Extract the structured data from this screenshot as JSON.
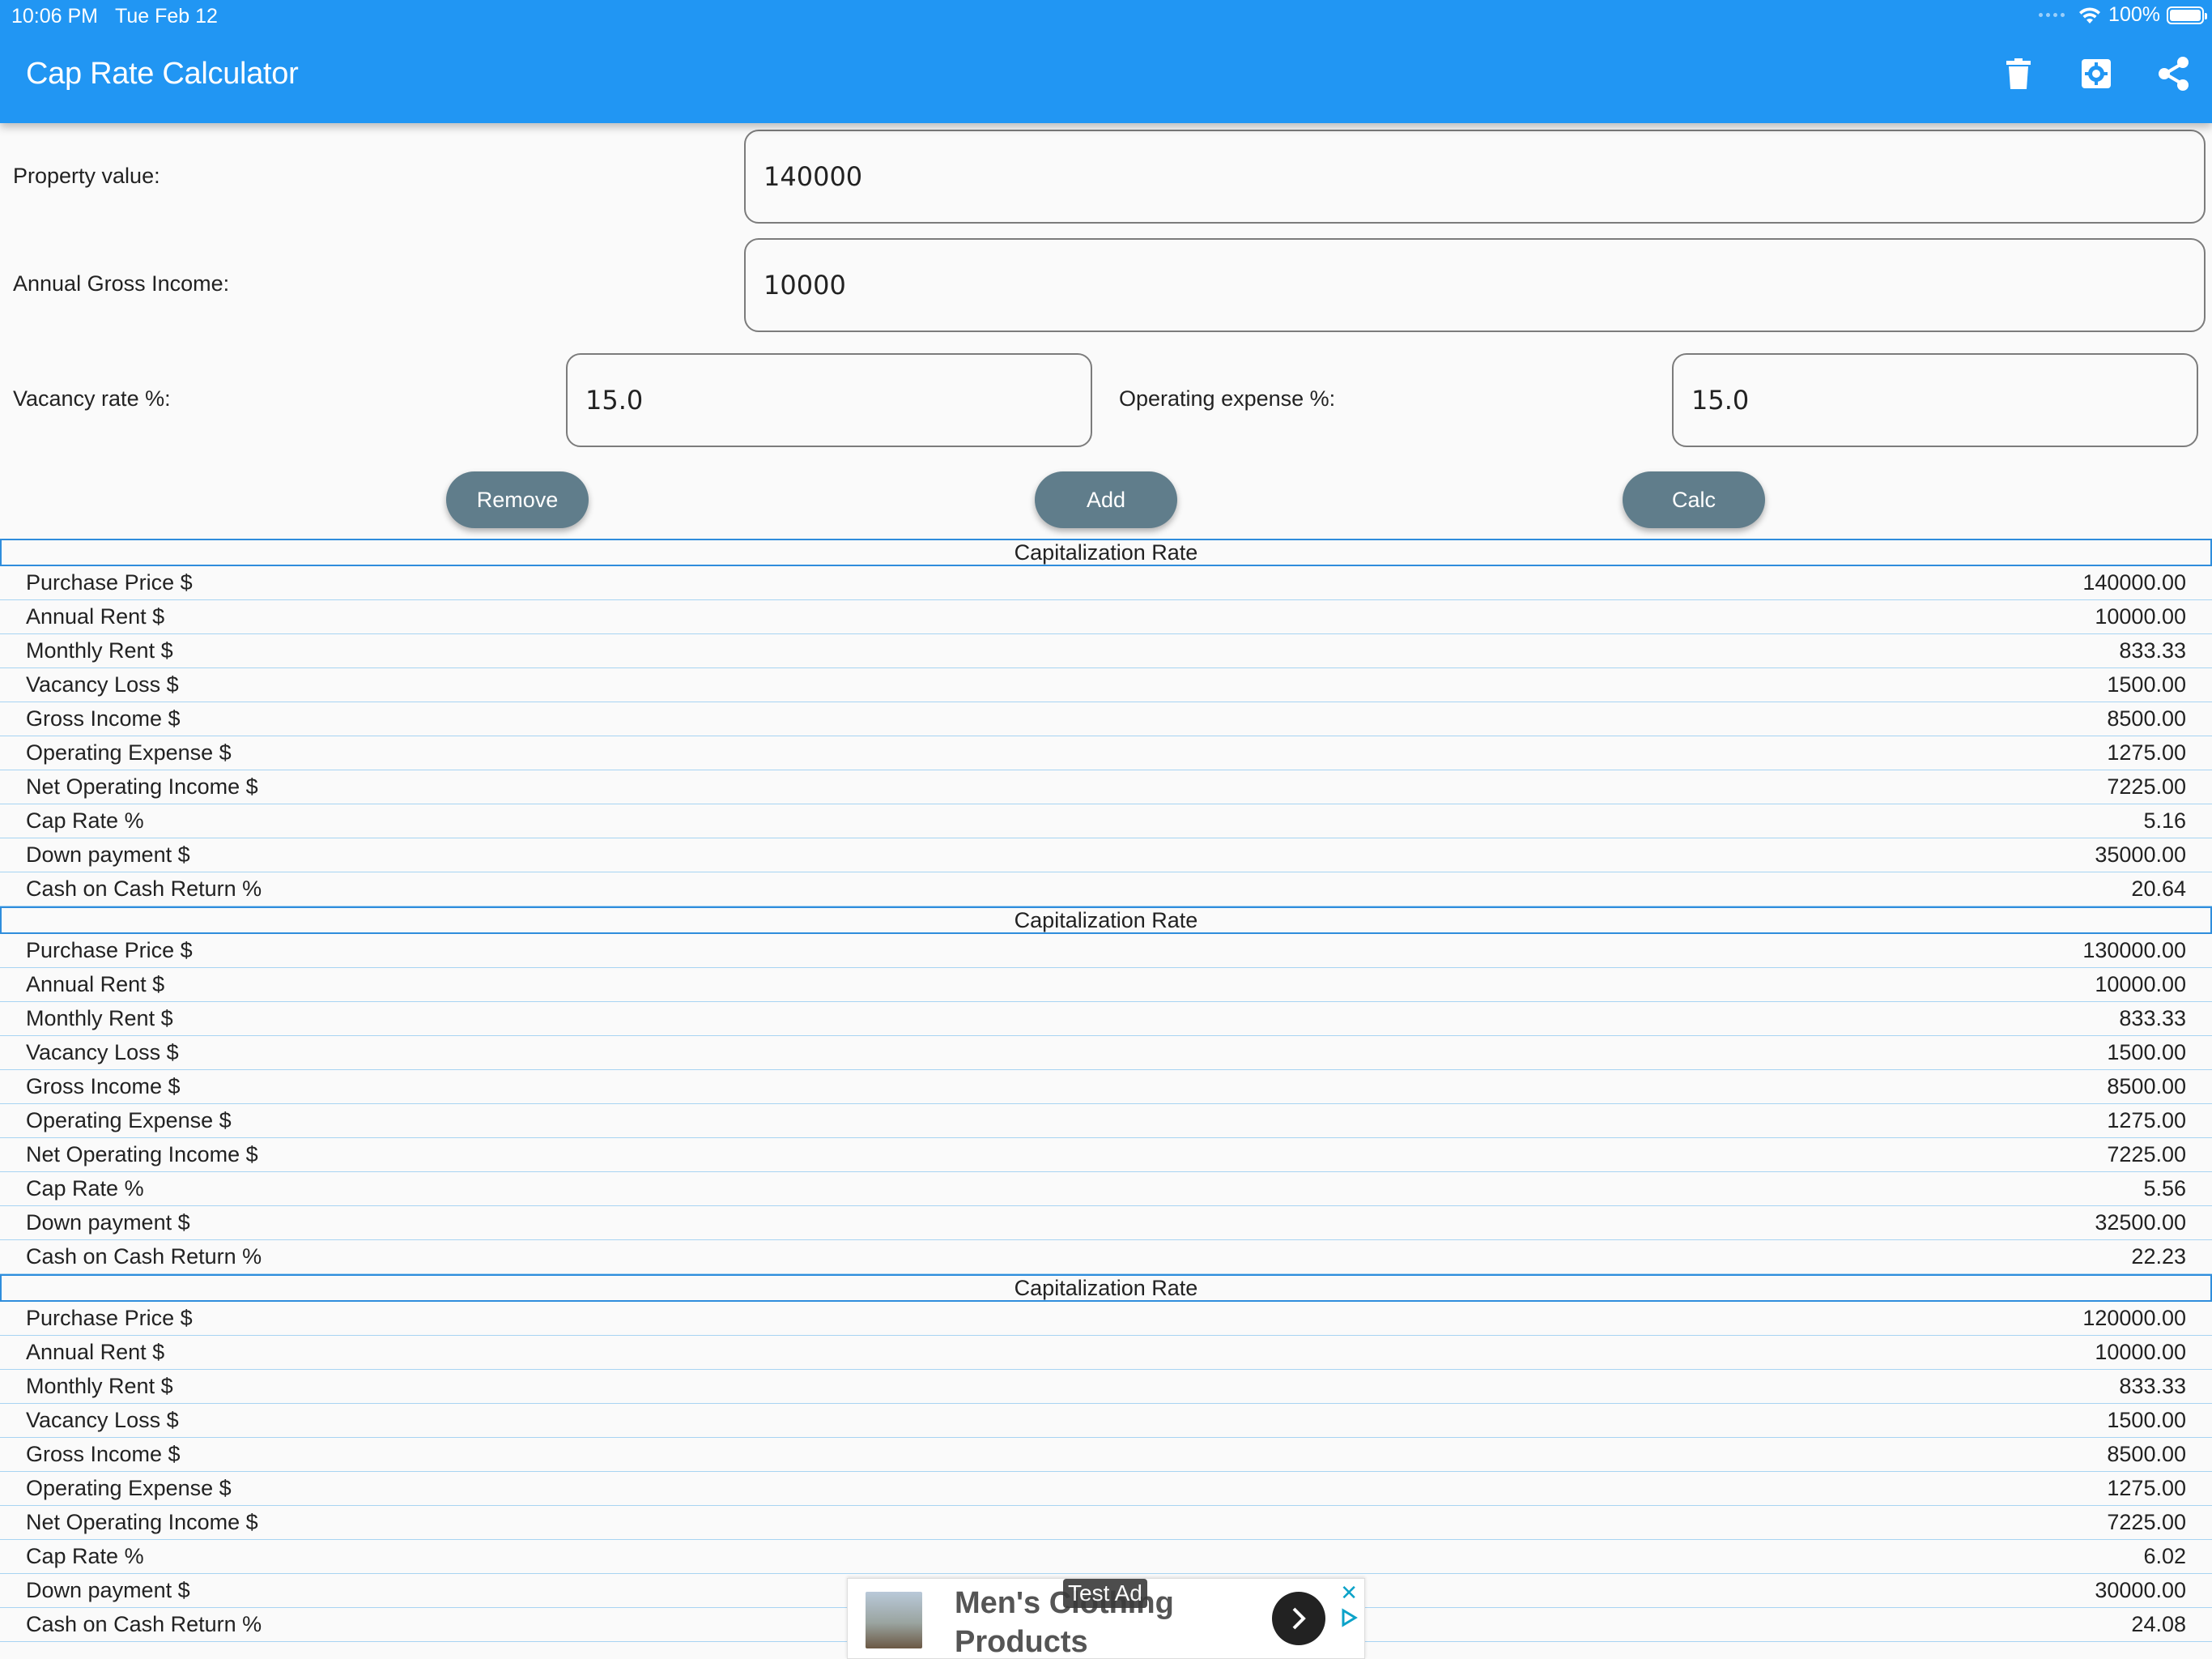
{
  "status_bar": {
    "time": "10:06 PM",
    "date": "Tue Feb 12",
    "battery": "100%"
  },
  "app_bar": {
    "title": "Cap Rate Calculator"
  },
  "form": {
    "property_value_label": "Property value:",
    "property_value": "140000",
    "annual_gross_income_label": "Annual Gross Income:",
    "annual_gross_income": "10000",
    "vacancy_rate_label": "Vacancy rate %:",
    "vacancy_rate": "15.0",
    "operating_expense_label": "Operating expense %:",
    "operating_expense": "15.0"
  },
  "buttons": {
    "remove": "Remove",
    "add": "Add",
    "calc": "Calc"
  },
  "results": [
    {
      "header": "Capitalization Rate",
      "rows": [
        {
          "k": "Purchase Price $",
          "v": "140000.00"
        },
        {
          "k": "Annual Rent $",
          "v": "10000.00"
        },
        {
          "k": "Monthly Rent $",
          "v": "833.33"
        },
        {
          "k": "Vacancy Loss $",
          "v": "1500.00"
        },
        {
          "k": "Gross Income $",
          "v": "8500.00"
        },
        {
          "k": "Operating Expense $",
          "v": "1275.00"
        },
        {
          "k": "Net Operating Income $",
          "v": "7225.00"
        },
        {
          "k": "Cap Rate %",
          "v": "5.16"
        },
        {
          "k": "Down payment $",
          "v": "35000.00"
        },
        {
          "k": "Cash on Cash Return %",
          "v": "20.64"
        }
      ]
    },
    {
      "header": "Capitalization Rate",
      "rows": [
        {
          "k": "Purchase Price $",
          "v": "130000.00"
        },
        {
          "k": "Annual Rent $",
          "v": "10000.00"
        },
        {
          "k": "Monthly Rent $",
          "v": "833.33"
        },
        {
          "k": "Vacancy Loss $",
          "v": "1500.00"
        },
        {
          "k": "Gross Income $",
          "v": "8500.00"
        },
        {
          "k": "Operating Expense $",
          "v": "1275.00"
        },
        {
          "k": "Net Operating Income $",
          "v": "7225.00"
        },
        {
          "k": "Cap Rate %",
          "v": "5.56"
        },
        {
          "k": "Down payment $",
          "v": "32500.00"
        },
        {
          "k": "Cash on Cash Return %",
          "v": "22.23"
        }
      ]
    },
    {
      "header": "Capitalization Rate",
      "rows": [
        {
          "k": "Purchase Price $",
          "v": "120000.00"
        },
        {
          "k": "Annual Rent $",
          "v": "10000.00"
        },
        {
          "k": "Monthly Rent $",
          "v": "833.33"
        },
        {
          "k": "Vacancy Loss $",
          "v": "1500.00"
        },
        {
          "k": "Gross Income $",
          "v": "8500.00"
        },
        {
          "k": "Operating Expense $",
          "v": "1275.00"
        },
        {
          "k": "Net Operating Income $",
          "v": "7225.00"
        },
        {
          "k": "Cap Rate %",
          "v": "6.02"
        },
        {
          "k": "Down payment $",
          "v": "30000.00"
        },
        {
          "k": "Cash on Cash Return %",
          "v": "24.08"
        }
      ]
    }
  ],
  "ad": {
    "title": "Men's Clothing Products",
    "badge": "Test Ad"
  },
  "colors": {
    "app_bar": "#2196f3",
    "button": "#607d8b",
    "section_border": "#2f8ddc",
    "row_divider": "#a8d4f2"
  },
  "icons": {
    "delete": "trash-icon",
    "settings": "settings-icon",
    "share": "share-icon"
  }
}
